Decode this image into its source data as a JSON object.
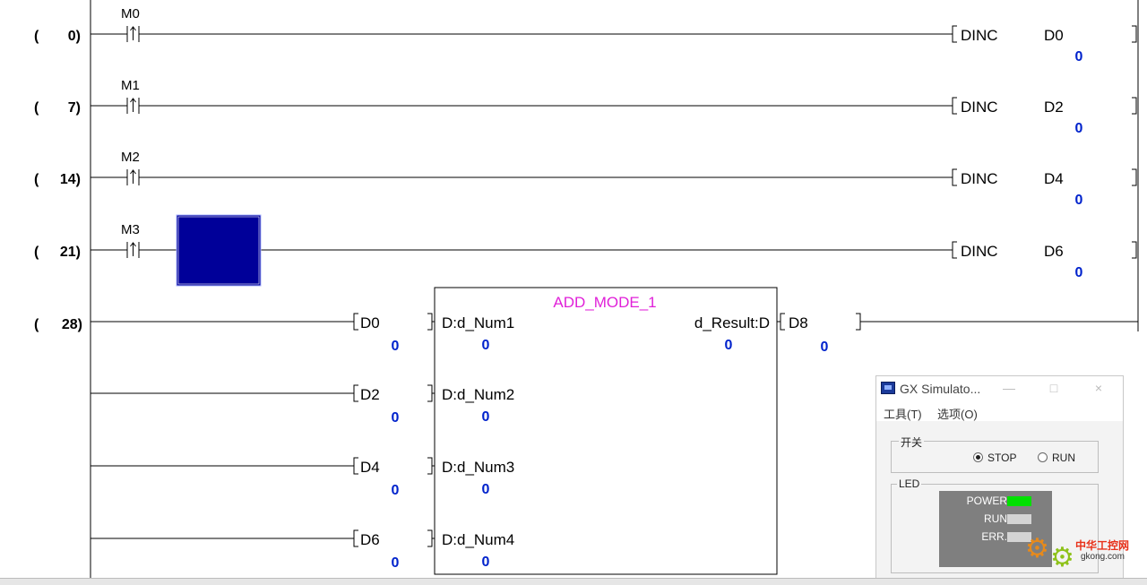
{
  "rungs": [
    {
      "step": "(",
      "num": "0)",
      "contact": "M0",
      "instruction": "DINC",
      "device": "D0",
      "value": "0"
    },
    {
      "step": "(",
      "num": "7)",
      "contact": "M1",
      "instruction": "DINC",
      "device": "D2",
      "value": "0"
    },
    {
      "step": "(",
      "num": "14)",
      "contact": "M2",
      "instruction": "DINC",
      "device": "D4",
      "value": "0"
    },
    {
      "step": "(",
      "num": "21)",
      "contact": "M3",
      "instruction": "DINC",
      "device": "D6",
      "value": "0"
    }
  ],
  "fb_rung": {
    "step": "(",
    "num": "28)",
    "fb_name": "ADD_MODE_1",
    "inputs": [
      {
        "device": "D0",
        "value": "0",
        "pin": "D:d_Num1",
        "pin_value": "0"
      },
      {
        "device": "D2",
        "value": "0",
        "pin": "D:d_Num2",
        "pin_value": "0"
      },
      {
        "device": "D4",
        "value": "0",
        "pin": "D:d_Num3",
        "pin_value": "0"
      },
      {
        "device": "D6",
        "value": "0",
        "pin": "D:d_Num4",
        "pin_value": "0"
      }
    ],
    "output_pin": "d_Result:D",
    "output_pin_value": "0",
    "output_device": "D8",
    "output_value": "0"
  },
  "simulator": {
    "title": "GX Simulato...",
    "minimize": "—",
    "maximize": "□",
    "close": "×",
    "menu": [
      "工具(T)",
      "选项(O)"
    ],
    "switch_group": "开关",
    "stop_label": "STOP",
    "run_label": "RUN",
    "selected_mode": "STOP",
    "led_group": "LED",
    "leds": [
      {
        "label": "POWER",
        "color": "#00e000"
      },
      {
        "label": "RUN",
        "color": "#d4d4d4"
      },
      {
        "label": "ERR.",
        "color": "#d4d4d4"
      }
    ]
  },
  "watermark": {
    "cn": "中华工控网",
    "url": "gkong.com"
  },
  "colors": {
    "value_blue": "#0022cc",
    "fb_magenta": "#e020d8",
    "cursor_blue": "#000099"
  }
}
